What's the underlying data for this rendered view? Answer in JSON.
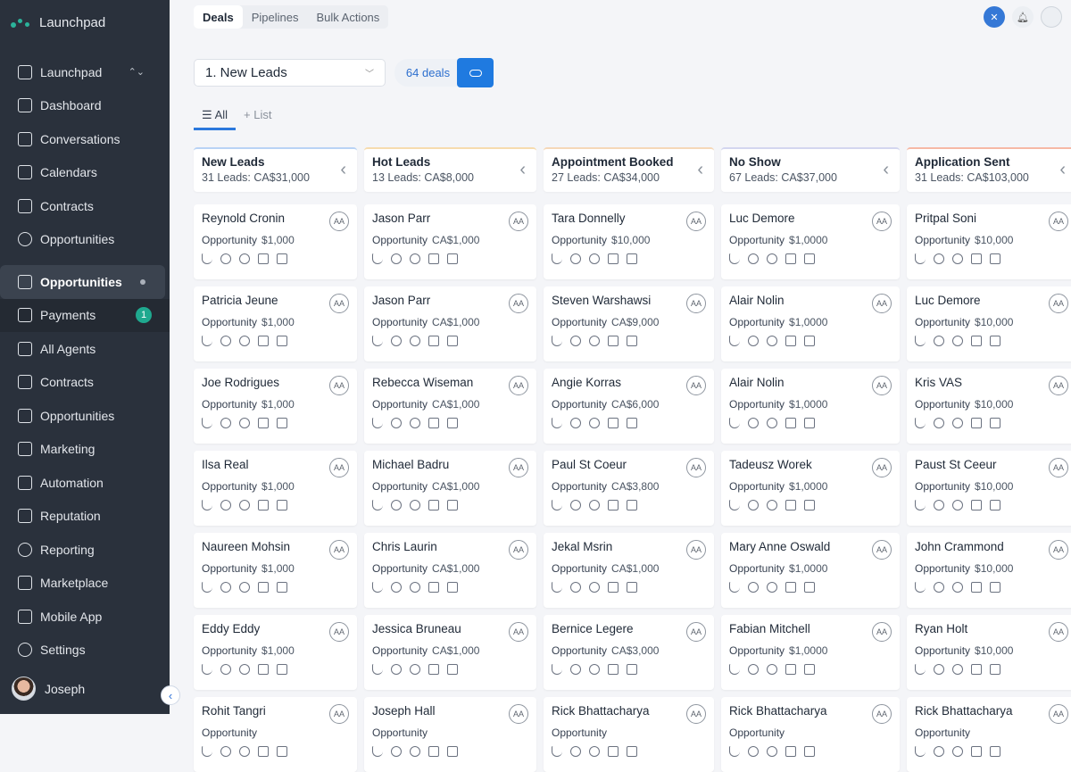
{
  "app": {
    "name": "Launchpad"
  },
  "sidebar": {
    "items": [
      {
        "label": "Launchpad",
        "icon": "launchpad-icon",
        "chevron": "⌃⌄"
      },
      {
        "label": "Dashboard",
        "icon": "dashboard-icon"
      },
      {
        "label": "Conversations",
        "icon": "chat-icon"
      },
      {
        "label": "Calendars",
        "icon": "calendar-icon"
      },
      {
        "label": "Contracts",
        "icon": "contract-icon"
      },
      {
        "label": "Opportunities",
        "icon": "circle-icon"
      },
      {
        "label": "Opportunities",
        "icon": "layers-icon",
        "active": true
      },
      {
        "label": "Payments",
        "icon": "payments-icon",
        "badge": "1"
      },
      {
        "label": "All Agents",
        "icon": "agents-icon"
      },
      {
        "label": "Contracts",
        "icon": "contract-icon"
      },
      {
        "label": "Opportunities",
        "icon": "inbox-icon"
      },
      {
        "label": "Marketing",
        "icon": "marketing-icon"
      },
      {
        "label": "Automation",
        "icon": "automation-icon"
      },
      {
        "label": "Reputation",
        "icon": "reputation-icon"
      },
      {
        "label": "Reporting",
        "icon": "reporting-icon"
      },
      {
        "label": "Marketplace",
        "icon": "marketplace-icon"
      },
      {
        "label": "Mobile App",
        "icon": "mobile-icon"
      },
      {
        "label": "Settings",
        "icon": "gear-icon"
      }
    ],
    "user": "Joseph"
  },
  "tabs": [
    "Deals",
    "Pipelines",
    "Bulk Actions"
  ],
  "pipeline": {
    "selected": "1. New Leads",
    "count": "64 deals"
  },
  "views": {
    "all": "All",
    "add_list": "List"
  },
  "columns": [
    {
      "title": "New Leads",
      "summary": "31 Leads: CA$31,000",
      "color": "#b9d3f5",
      "cards": [
        [
          "Reynold Cronin",
          "$1,000"
        ],
        [
          "Patricia Jeune",
          "$1,000"
        ],
        [
          "Joe Rodrigues",
          "$1,000"
        ],
        [
          "Ilsa Real",
          "$1,000"
        ],
        [
          "Naureen Mohsin",
          "$1,000"
        ],
        [
          "Eddy Eddy",
          "$1,000"
        ],
        [
          "Rohit Tangri",
          ""
        ]
      ]
    },
    {
      "title": "Hot Leads",
      "summary": "13 Leads: CA$8,000",
      "color": "#f6dcae",
      "cards": [
        [
          "Jason Parr",
          "CA$1,000"
        ],
        [
          "Jason Parr",
          "CA$1,000"
        ],
        [
          "Rebecca Wiseman",
          "CA$1,000"
        ],
        [
          "Michael Badru",
          "CA$1,000"
        ],
        [
          "Chris Laurin",
          "CA$1,000"
        ],
        [
          "Jessica Bruneau",
          "CA$1,000"
        ],
        [
          "Joseph Hall",
          ""
        ]
      ]
    },
    {
      "title": "Appointment Booked",
      "summary": "27 Leads: CA$34,000",
      "color": "#f5d8b8",
      "cards": [
        [
          "Tara Donnelly",
          "$10,000"
        ],
        [
          "Steven Warshawsi",
          "CA$9,000"
        ],
        [
          "Angie Korras",
          "CA$6,000"
        ],
        [
          "Paul St Coeur",
          "CA$3,800"
        ],
        [
          "Jekal Msrin",
          "CA$1,000"
        ],
        [
          "Bernice Legere",
          "CA$3,000"
        ],
        [
          "Rick Bhattacharya",
          ""
        ]
      ]
    },
    {
      "title": "No Show",
      "summary": "67 Leads: CA$37,000",
      "color": "#d3d6ef",
      "cards": [
        [
          "Luc Demore",
          "$1,0000"
        ],
        [
          "Alair Nolin",
          "$1,0000"
        ],
        [
          "Alair Nolin",
          "$1,0000"
        ],
        [
          "Tadeusz Worek",
          "$1,0000"
        ],
        [
          "Mary Anne Oswald",
          "$1,0000"
        ],
        [
          "Fabian Mitchell",
          "$1,0000"
        ],
        [
          "Rick Bhattacharya",
          ""
        ]
      ]
    },
    {
      "title": "Application Sent",
      "summary": "31 Leads: CA$103,000",
      "color": "#f6b9a6",
      "cards": [
        [
          "Pritpal Soni",
          "$10,000"
        ],
        [
          "Luc Demore",
          "$10,000"
        ],
        [
          "Kris VAS",
          "$10,000"
        ],
        [
          "Paust St Ceeur",
          "$10,000"
        ],
        [
          "John Crammond",
          "$10,000"
        ],
        [
          "Ryan Holt",
          "$10,000"
        ],
        [
          "Rick Bhattacharya",
          ""
        ]
      ]
    }
  ],
  "card_labels": {
    "opportunity": "Opportunity",
    "assignee": "AA"
  }
}
